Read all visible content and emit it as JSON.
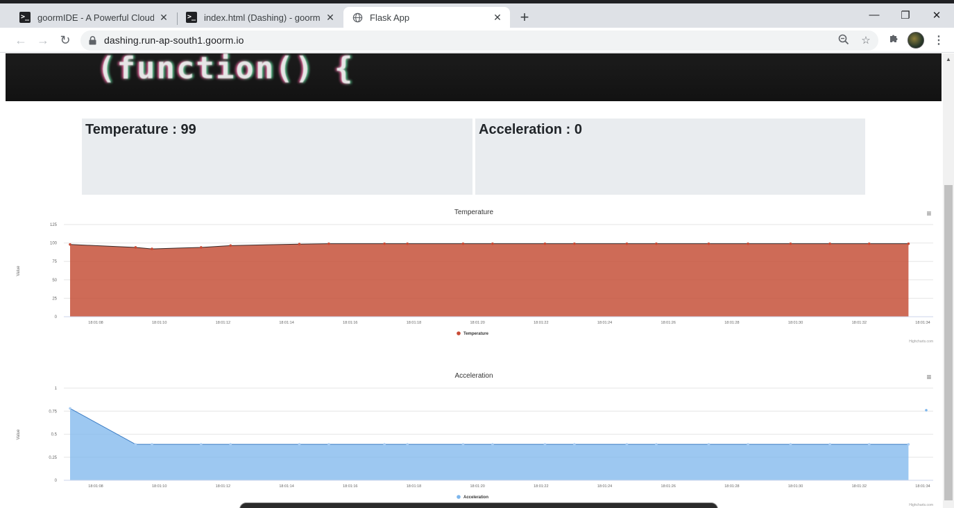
{
  "browser": {
    "tabs": [
      {
        "title": "goormIDE - A Powerful Cloud IDE",
        "icon": "terminal-icon",
        "active": false
      },
      {
        "title": "index.html (Dashing) - goormIDE",
        "icon": "terminal-icon",
        "active": false
      },
      {
        "title": "Flask App",
        "icon": "globe-icon",
        "active": true
      }
    ],
    "new_tab_label": "+",
    "window_controls": {
      "minimize": "—",
      "maximize": "❐",
      "close": "✕"
    },
    "nav": {
      "back": "←",
      "forward": "→",
      "reload": "↻"
    },
    "url": "dashing.run-ap-south1.goorm.io",
    "toolbar_icons": {
      "zoom": "zoom-icon",
      "bookmark": "star-icon",
      "extensions": "puzzle-icon",
      "menu": "⋮"
    }
  },
  "hero": {
    "code_text": "(function()  {"
  },
  "cards": [
    {
      "text": "Temperature : 99"
    },
    {
      "text": "Acceleration : 0"
    }
  ],
  "charts": [
    {
      "title": "Temperature",
      "y_title": "Value",
      "credits": "Highcharts.com",
      "menu_icon": "≡"
    },
    {
      "title": "Acceleration",
      "y_title": "Value",
      "credits": "Highcharts.com",
      "menu_icon": "≡"
    }
  ],
  "chart_data": [
    {
      "type": "area",
      "title": "Temperature",
      "ylabel": "Value",
      "ylim": [
        0,
        125
      ],
      "yticks": [
        0,
        25,
        50,
        75,
        100,
        125
      ],
      "xticks": [
        "18:01:08",
        "18:01:10",
        "18:01:12",
        "18:01:14",
        "18:01:16",
        "18:01:18",
        "18:01:20",
        "18:01:22",
        "18:01:24",
        "18:01:26",
        "18:01:28",
        "18:01:30",
        "18:01:32",
        "18:01:34"
      ],
      "x": [
        7.9,
        9.9,
        10.4,
        11.9,
        12.8,
        14.9,
        15.8,
        17.5,
        18.2,
        19.9,
        20.8,
        22.4,
        23.3,
        24.9,
        25.8,
        27.4,
        28.6,
        29.9,
        31.1,
        32.3,
        33.5
      ],
      "series": [
        {
          "name": "Temperature",
          "color": "#d36d57",
          "values": [
            98,
            94,
            92,
            94,
            96.5,
            98.5,
            99,
            99,
            99,
            99,
            99,
            99,
            99,
            99,
            99,
            99,
            99,
            99,
            99,
            99,
            99
          ]
        }
      ],
      "grid": true,
      "legend": "bottom-center"
    },
    {
      "type": "area",
      "title": "Acceleration",
      "ylabel": "Value",
      "ylim": [
        0,
        1
      ],
      "yticks": [
        0,
        0.25,
        0.5,
        0.75,
        1
      ],
      "xticks": [
        "18:01:08",
        "18:01:10",
        "18:01:12",
        "18:01:14",
        "18:01:16",
        "18:01:18",
        "18:01:20",
        "18:01:22",
        "18:01:24",
        "18:01:26",
        "18:01:28",
        "18:01:30",
        "18:01:32",
        "18:01:34"
      ],
      "x": [
        7.9,
        9.9,
        10.4,
        11.9,
        12.8,
        14.9,
        15.8,
        17.5,
        18.2,
        19.9,
        20.8,
        22.4,
        23.3,
        24.9,
        25.8,
        27.4,
        28.6,
        29.9,
        31.1,
        32.3,
        33.5
      ],
      "series": [
        {
          "name": "Acceleration",
          "color": "#7cb5ec",
          "values": [
            0.78,
            0.39,
            0.39,
            0.39,
            0.39,
            0.39,
            0.39,
            0.39,
            0.39,
            0.39,
            0.39,
            0.39,
            0.39,
            0.39,
            0.39,
            0.39,
            0.39,
            0.39,
            0.39,
            0.39,
            0.39
          ]
        }
      ],
      "extra_point": {
        "x": 34,
        "y": 0.76
      },
      "grid": true,
      "legend": "bottom-center"
    }
  ]
}
